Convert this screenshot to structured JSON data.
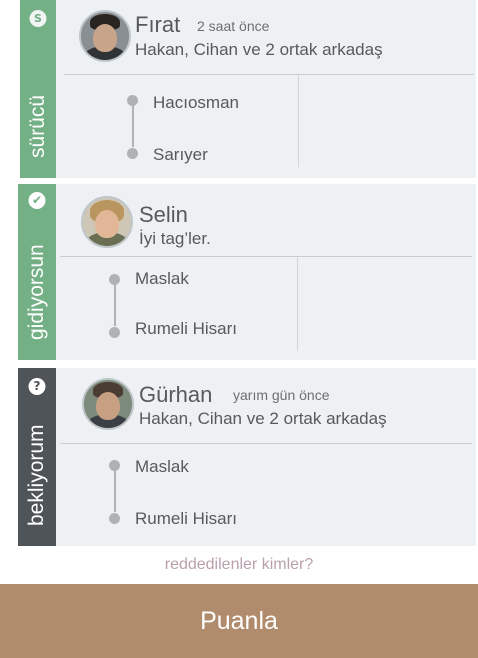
{
  "colors": {
    "accepted": "#74b085",
    "waiting": "#4e5457",
    "card_bg": "#edf1f4",
    "rate_button": "#b08c6c",
    "link": "#b9a0ac"
  },
  "cards": [
    {
      "status_icon": "S",
      "status_label": "sürücü",
      "name": "Fırat",
      "time": "2 saat önce",
      "subtitle": "Hakan, Cihan ve 2 ortak arkadaş",
      "route": {
        "from": "Hacıosman",
        "to": "Sarıyer"
      }
    },
    {
      "status_icon": "✔",
      "status_label": "gidiyorsun",
      "name": "Selin",
      "time": "",
      "subtitle": "İyi tag’ler.",
      "route": {
        "from": "Maslak",
        "to": "Rumeli Hisarı"
      }
    },
    {
      "status_icon": "?",
      "status_label": "bekliyorum",
      "name": "Gürhan",
      "time": "yarım gün önce",
      "subtitle": "Hakan, Cihan ve 2 ortak arkadaş",
      "route": {
        "from": "Maslak",
        "to": "Rumeli Hisarı"
      }
    }
  ],
  "rejected_link": "reddedilenler kimler?",
  "rate_button": "Puanla"
}
